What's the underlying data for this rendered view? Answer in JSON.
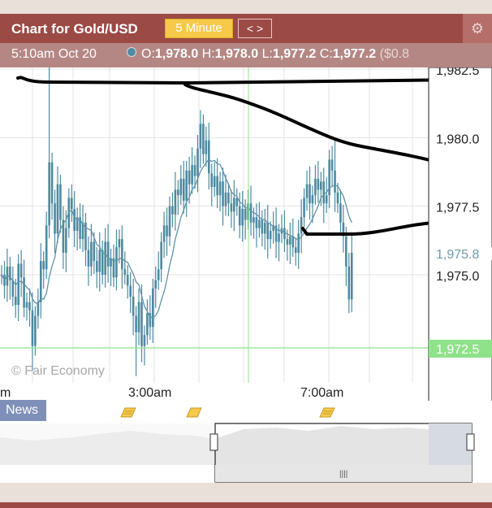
{
  "header": {
    "title": "Chart for Gold/USD",
    "timeframe_label": "5 Minute",
    "nav_label": "< >",
    "settings_icon": "gear-icon"
  },
  "ohlc_bar": {
    "time": "5:10am Oct 20",
    "o_label": "O:",
    "o": "1,978.0",
    "h_label": "H:",
    "h": "1,978.0",
    "l_label": "L:",
    "l": "1,977.2",
    "c_label": "C:",
    "c": "1,977.2",
    "change": "($0.8"
  },
  "watermark": "© Fair Economy",
  "news_label": "News",
  "colors": {
    "candle": "#4e8aa0",
    "ma": "#5f93a6",
    "grid": "#e3e3e3",
    "current_line": "#8fe28a",
    "current_label_bg": "#8fe28a",
    "title_bg": "#9b4a45",
    "ohlc_bg": "#b58784",
    "accent": "#f7c94a"
  },
  "chart_data": {
    "type": "candlestick",
    "instrument": "Gold/USD",
    "interval": "5 Minute",
    "ylim": [
      1971.0,
      1983.0
    ],
    "y_ticks": [
      "1,982.5",
      "1,980.0",
      "1,977.5",
      "1,975.0"
    ],
    "x_ticks": [
      "m",
      "3:00am",
      "7:00am"
    ],
    "price_labels": {
      "low_marker": "1,975.8",
      "current": "1,972.5"
    },
    "grid": true,
    "closes": [
      1975.0,
      1974.6,
      1975.3,
      1974.8,
      1974.2,
      1973.9,
      1975.4,
      1974.9,
      1973.8,
      1974.0,
      1973.7,
      1972.4,
      1973.5,
      1974.0,
      1975.5,
      1975.2,
      1976.8,
      1979.1,
      1977.6,
      1976.5,
      1978.3,
      1977.0,
      1975.8,
      1976.7,
      1977.8,
      1977.4,
      1976.6,
      1977.1,
      1976.3,
      1976.9,
      1975.9,
      1975.3,
      1976.2,
      1975.5,
      1975.1,
      1975.9,
      1975.0,
      1976.2,
      1975.3,
      1975.6,
      1974.9,
      1976.0,
      1976.3,
      1975.2,
      1975.0,
      1974.6,
      1974.2,
      1973.5,
      1972.9,
      1974.0,
      1972.4,
      1972.8,
      1973.6,
      1973.1,
      1974.5,
      1974.8,
      1975.2,
      1976.2,
      1976.8,
      1976.4,
      1977.5,
      1977.2,
      1978.1,
      1977.9,
      1978.5,
      1977.7,
      1978.8,
      1978.3,
      1979.0,
      1978.6,
      1979.6,
      1980.5,
      1979.4,
      1979.9,
      1978.7,
      1978.2,
      1978.6,
      1977.9,
      1978.4,
      1977.5,
      1978.0,
      1977.6,
      1977.3,
      1977.8,
      1977.5,
      1976.8,
      1977.4,
      1977.0,
      1977.6,
      1976.9,
      1977.1,
      1976.7,
      1977.0,
      1976.5,
      1976.9,
      1976.3,
      1976.6,
      1976.8,
      1976.2,
      1976.5,
      1976.7,
      1976.3,
      1976.1,
      1976.4,
      1976.0,
      1975.8,
      1976.5,
      1977.1,
      1977.8,
      1978.3,
      1977.6,
      1977.9,
      1978.5,
      1978.1,
      1978.4,
      1977.6,
      1977.9,
      1979.2,
      1978.8,
      1978.0,
      1977.6,
      1976.9,
      1976.4,
      1975.3,
      1974.1,
      1975.8
    ]
  }
}
